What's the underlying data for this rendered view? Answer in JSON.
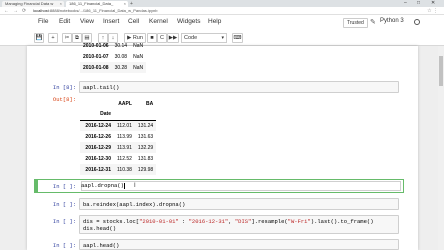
{
  "browser": {
    "tabs": [
      {
        "label": "Managing Financial Data w"
      },
      {
        "label": "186_11_Financial_Data_"
      }
    ],
    "new_tab": "+",
    "nav_back": "←",
    "nav_forward": "→",
    "nav_reload": "⟳",
    "url_host": "localhost",
    "url_path": ":8888/notebooks/.../186_11_Financial_Data_w_Pandas.ipynb",
    "minimize": "–",
    "maximize": "□",
    "close": "✕"
  },
  "menu": {
    "items": [
      "File",
      "Edit",
      "View",
      "Insert",
      "Cell",
      "Kernel",
      "Widgets",
      "Help"
    ],
    "trusted": "Trusted",
    "kernel": "Python 3"
  },
  "toolbar": {
    "save": "💾",
    "add": "+",
    "cut": "✂",
    "copy": "⧉",
    "paste": "▤",
    "up": "↑",
    "down": "↓",
    "run": "▶ Run",
    "stop": "■",
    "restart": "C",
    "fast_forward": "▶▶",
    "cell_type": "Code",
    "keyboard": "⌨"
  },
  "top_table": {
    "rows": [
      {
        "date": "2010-01-06",
        "aapl": "30.14",
        "ba": "NaN"
      },
      {
        "date": "2010-01-07",
        "aapl": "30.08",
        "ba": "NaN"
      },
      {
        "date": "2010-01-08",
        "aapl": "30.28",
        "ba": "NaN"
      }
    ]
  },
  "cell8": {
    "in_prompt": "In [8]:",
    "code": "aapl.tail()",
    "out_prompt": "Out[8]:",
    "headers": [
      "AAPL",
      "BA"
    ],
    "index_name": "Date",
    "rows": [
      {
        "date": "2016-12-24",
        "aapl": "112.01",
        "ba": "131.24"
      },
      {
        "date": "2016-12-26",
        "aapl": "113.99",
        "ba": "131.63"
      },
      {
        "date": "2016-12-29",
        "aapl": "113.91",
        "ba": "132.29"
      },
      {
        "date": "2016-12-30",
        "aapl": "112.52",
        "ba": "131.83"
      },
      {
        "date": "2016-12-31",
        "aapl": "110.38",
        "ba": "129.98"
      }
    ]
  },
  "cells": [
    {
      "prompt": "In [ ]:",
      "code": "aapl.dropna()"
    },
    {
      "prompt": "In [ ]:",
      "code": "ba.reindex(aapl.index).dropna()"
    },
    {
      "prompt": "In [ ]:",
      "code_a": "dis = stocks.loc[",
      "str1": "\"2010-01-01\"",
      "code_b": " : ",
      "str2": "\"2016-12-31\"",
      "code_c": ", ",
      "str3": "\"DIS\"",
      "code_d": "].resample(",
      "str4": "\"W-Fri\"",
      "code_e": ").last().to_frame()",
      "line2": "dis.head()"
    },
    {
      "prompt": "In [ ]:",
      "code": "aapl.head()"
    }
  ]
}
